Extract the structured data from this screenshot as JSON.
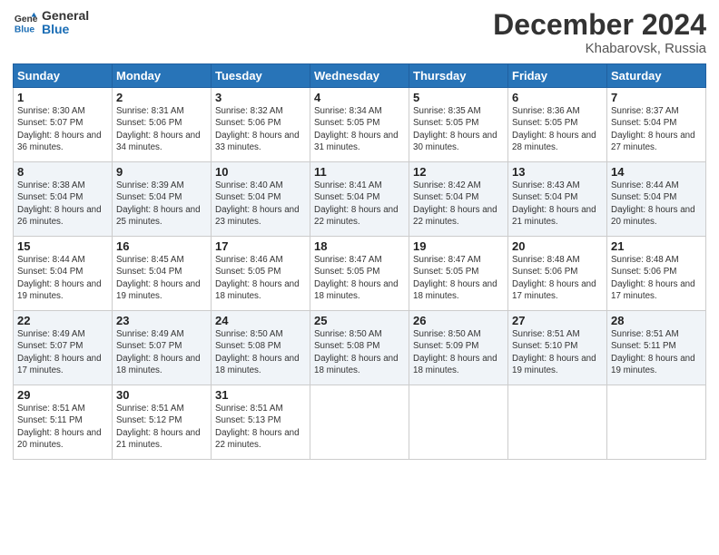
{
  "header": {
    "logo_general": "General",
    "logo_blue": "Blue",
    "month_title": "December 2024",
    "location": "Khabarovsk, Russia"
  },
  "weekdays": [
    "Sunday",
    "Monday",
    "Tuesday",
    "Wednesday",
    "Thursday",
    "Friday",
    "Saturday"
  ],
  "weeks": [
    [
      {
        "day": "1",
        "sunrise": "8:30 AM",
        "sunset": "5:07 PM",
        "daylight": "8 hours and 36 minutes."
      },
      {
        "day": "2",
        "sunrise": "8:31 AM",
        "sunset": "5:06 PM",
        "daylight": "8 hours and 34 minutes."
      },
      {
        "day": "3",
        "sunrise": "8:32 AM",
        "sunset": "5:06 PM",
        "daylight": "8 hours and 33 minutes."
      },
      {
        "day": "4",
        "sunrise": "8:34 AM",
        "sunset": "5:05 PM",
        "daylight": "8 hours and 31 minutes."
      },
      {
        "day": "5",
        "sunrise": "8:35 AM",
        "sunset": "5:05 PM",
        "daylight": "8 hours and 30 minutes."
      },
      {
        "day": "6",
        "sunrise": "8:36 AM",
        "sunset": "5:05 PM",
        "daylight": "8 hours and 28 minutes."
      },
      {
        "day": "7",
        "sunrise": "8:37 AM",
        "sunset": "5:04 PM",
        "daylight": "8 hours and 27 minutes."
      }
    ],
    [
      {
        "day": "8",
        "sunrise": "8:38 AM",
        "sunset": "5:04 PM",
        "daylight": "8 hours and 26 minutes."
      },
      {
        "day": "9",
        "sunrise": "8:39 AM",
        "sunset": "5:04 PM",
        "daylight": "8 hours and 25 minutes."
      },
      {
        "day": "10",
        "sunrise": "8:40 AM",
        "sunset": "5:04 PM",
        "daylight": "8 hours and 23 minutes."
      },
      {
        "day": "11",
        "sunrise": "8:41 AM",
        "sunset": "5:04 PM",
        "daylight": "8 hours and 22 minutes."
      },
      {
        "day": "12",
        "sunrise": "8:42 AM",
        "sunset": "5:04 PM",
        "daylight": "8 hours and 22 minutes."
      },
      {
        "day": "13",
        "sunrise": "8:43 AM",
        "sunset": "5:04 PM",
        "daylight": "8 hours and 21 minutes."
      },
      {
        "day": "14",
        "sunrise": "8:44 AM",
        "sunset": "5:04 PM",
        "daylight": "8 hours and 20 minutes."
      }
    ],
    [
      {
        "day": "15",
        "sunrise": "8:44 AM",
        "sunset": "5:04 PM",
        "daylight": "8 hours and 19 minutes."
      },
      {
        "day": "16",
        "sunrise": "8:45 AM",
        "sunset": "5:04 PM",
        "daylight": "8 hours and 19 minutes."
      },
      {
        "day": "17",
        "sunrise": "8:46 AM",
        "sunset": "5:05 PM",
        "daylight": "8 hours and 18 minutes."
      },
      {
        "day": "18",
        "sunrise": "8:47 AM",
        "sunset": "5:05 PM",
        "daylight": "8 hours and 18 minutes."
      },
      {
        "day": "19",
        "sunrise": "8:47 AM",
        "sunset": "5:05 PM",
        "daylight": "8 hours and 18 minutes."
      },
      {
        "day": "20",
        "sunrise": "8:48 AM",
        "sunset": "5:06 PM",
        "daylight": "8 hours and 17 minutes."
      },
      {
        "day": "21",
        "sunrise": "8:48 AM",
        "sunset": "5:06 PM",
        "daylight": "8 hours and 17 minutes."
      }
    ],
    [
      {
        "day": "22",
        "sunrise": "8:49 AM",
        "sunset": "5:07 PM",
        "daylight": "8 hours and 17 minutes."
      },
      {
        "day": "23",
        "sunrise": "8:49 AM",
        "sunset": "5:07 PM",
        "daylight": "8 hours and 18 minutes."
      },
      {
        "day": "24",
        "sunrise": "8:50 AM",
        "sunset": "5:08 PM",
        "daylight": "8 hours and 18 minutes."
      },
      {
        "day": "25",
        "sunrise": "8:50 AM",
        "sunset": "5:08 PM",
        "daylight": "8 hours and 18 minutes."
      },
      {
        "day": "26",
        "sunrise": "8:50 AM",
        "sunset": "5:09 PM",
        "daylight": "8 hours and 18 minutes."
      },
      {
        "day": "27",
        "sunrise": "8:51 AM",
        "sunset": "5:10 PM",
        "daylight": "8 hours and 19 minutes."
      },
      {
        "day": "28",
        "sunrise": "8:51 AM",
        "sunset": "5:11 PM",
        "daylight": "8 hours and 19 minutes."
      }
    ],
    [
      {
        "day": "29",
        "sunrise": "8:51 AM",
        "sunset": "5:11 PM",
        "daylight": "8 hours and 20 minutes."
      },
      {
        "day": "30",
        "sunrise": "8:51 AM",
        "sunset": "5:12 PM",
        "daylight": "8 hours and 21 minutes."
      },
      {
        "day": "31",
        "sunrise": "8:51 AM",
        "sunset": "5:13 PM",
        "daylight": "8 hours and 22 minutes."
      },
      null,
      null,
      null,
      null
    ]
  ]
}
